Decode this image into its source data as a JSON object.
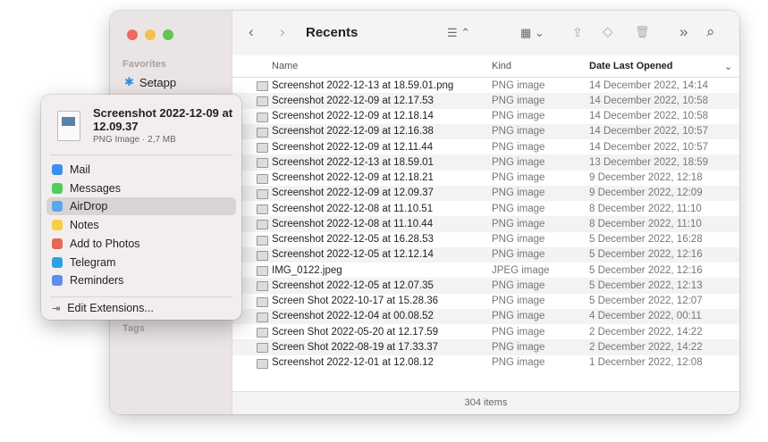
{
  "sidebar": {
    "favorites_label": "Favorites",
    "fav_item": "Setapp",
    "tags_label": "Tags"
  },
  "toolbar": {
    "title": "Recents",
    "back": "‹",
    "forward": "›",
    "list_icon": "☰ ⌃",
    "grid_icon": "▦ ⌄",
    "share_icon": "⇪",
    "tag_icon": "◇",
    "trash_icon": "🗑",
    "more_icon": "»",
    "search_icon": "⌕"
  },
  "columns": {
    "name": "Name",
    "kind": "Kind",
    "date": "Date Last Opened",
    "sort_icon": "⌄"
  },
  "files": [
    {
      "name": "Screenshot 2022-12-13 at 18.59.01.png",
      "kind": "PNG image",
      "date": "14 December 2022, 14:14"
    },
    {
      "name": "Screenshot 2022-12-09 at 12.17.53",
      "kind": "PNG image",
      "date": "14 December 2022, 10:58"
    },
    {
      "name": "Screenshot 2022-12-09 at 12.18.14",
      "kind": "PNG image",
      "date": "14 December 2022, 10:58"
    },
    {
      "name": "Screenshot 2022-12-09 at 12.16.38",
      "kind": "PNG image",
      "date": "14 December 2022, 10:57"
    },
    {
      "name": "Screenshot 2022-12-09 at 12.11.44",
      "kind": "PNG image",
      "date": "14 December 2022, 10:57"
    },
    {
      "name": "Screenshot 2022-12-13 at 18.59.01",
      "kind": "PNG image",
      "date": "13 December 2022, 18:59"
    },
    {
      "name": "Screenshot 2022-12-09 at 12.18.21",
      "kind": "PNG image",
      "date": "9 December 2022, 12:18"
    },
    {
      "name": "Screenshot 2022-12-09 at 12.09.37",
      "kind": "PNG image",
      "date": "9 December 2022, 12:09"
    },
    {
      "name": "Screenshot 2022-12-08 at 11.10.51",
      "kind": "PNG image",
      "date": "8 December 2022, 11:10"
    },
    {
      "name": "Screenshot 2022-12-08 at 11.10.44",
      "kind": "PNG image",
      "date": "8 December 2022, 11:10"
    },
    {
      "name": "Screenshot 2022-12-05 at 16.28.53",
      "kind": "PNG image",
      "date": "5 December 2022, 16:28"
    },
    {
      "name": "Screenshot 2022-12-05 at 12.12.14",
      "kind": "PNG image",
      "date": "5 December 2022, 12:16"
    },
    {
      "name": "IMG_0122.jpeg",
      "kind": "JPEG image",
      "date": "5 December 2022, 12:16"
    },
    {
      "name": "Screenshot 2022-12-05 at 12.07.35",
      "kind": "PNG image",
      "date": "5 December 2022, 12:13"
    },
    {
      "name": "Screen Shot 2022-10-17 at 15.28.36",
      "kind": "PNG image",
      "date": "5 December 2022, 12:07"
    },
    {
      "name": "Screenshot 2022-12-04 at 00.08.52",
      "kind": "PNG image",
      "date": "4 December 2022, 00:11"
    },
    {
      "name": "Screen Shot 2022-05-20 at 12.17.59",
      "kind": "PNG image",
      "date": "2 December 2022, 14:22"
    },
    {
      "name": "Screen Shot 2022-08-19 at 17.33.37",
      "kind": "PNG image",
      "date": "2 December 2022, 14:22"
    },
    {
      "name": "Screenshot 2022-12-01 at 12.08.12",
      "kind": "PNG image",
      "date": "1 December 2022, 12:08"
    }
  ],
  "status": "304 items",
  "popup": {
    "title": "Screenshot 2022-12-09 at 12.09.37",
    "subtitle": "PNG Image · 2,7 MB",
    "items": [
      {
        "label": "Mail",
        "color": "#3d8ef0"
      },
      {
        "label": "Messages",
        "color": "#4cd05b"
      },
      {
        "label": "AirDrop",
        "color": "#5aa7ea"
      },
      {
        "label": "Notes",
        "color": "#f7cf46"
      },
      {
        "label": "Add to Photos",
        "color": "#e8665a"
      },
      {
        "label": "Telegram",
        "color": "#2ba2e0"
      },
      {
        "label": "Reminders",
        "color": "#5b8ff0"
      }
    ],
    "edit": "Edit Extensions..."
  }
}
